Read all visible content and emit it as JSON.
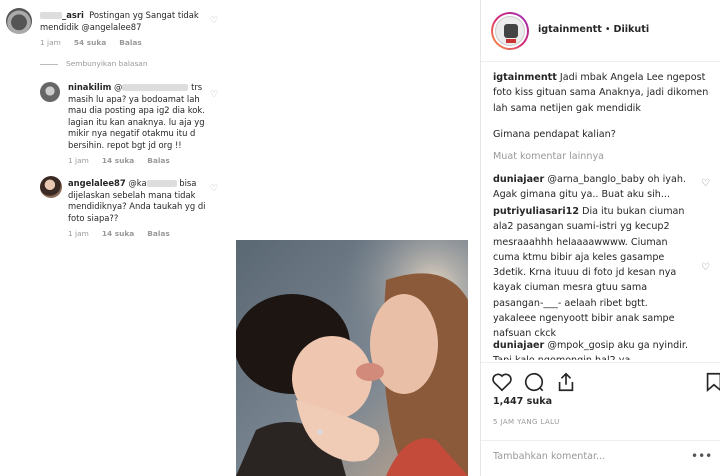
{
  "left_comments": {
    "top": {
      "username": "_asri",
      "text": "Postingan yg Sangat tidak mendidik @angelalee87",
      "time": "1 jam",
      "likes": "54 suka",
      "reply": "Balas"
    },
    "hide_replies": "Sembunyikan balasan",
    "reply1": {
      "username": "ninakilim",
      "mention": "@",
      "tail": "trs",
      "text": "masih lu apa? ya bodoamat lah mau dia posting apa ig2 dia kok. lagian itu kan anaknya. lu aja yg mikir nya negatif otakmu itu d bersihin. repot bgt jd org !!",
      "time": "1 jam",
      "likes": "14 suka",
      "reply": "Balas"
    },
    "reply2": {
      "username": "angelalee87",
      "mention": "@ka",
      "text": "bisa dijelaskan sebelah mana tidak mendidiknya? Anda taukah yg di foto siapa??",
      "time": "1 jam",
      "likes": "14 suka",
      "reply": "Balas"
    }
  },
  "post": {
    "username": "igtainmentt",
    "separator": "•",
    "follow_status": "Diikuti",
    "caption_user": "igtainmentt",
    "caption_text": "Jadi mbak Angela Lee ngepost foto kiss gituan sama Anaknya, jadi dikomen lah sama netijen gak mendidik",
    "question": "Gimana pendapat kalian?",
    "load_more": "Muat komentar lainnya",
    "comments": [
      {
        "user": "duniajaer",
        "text": "@arna_banglo_baby oh iyah. Agak gimana gitu ya.. Buat aku sih..."
      },
      {
        "user": "putriyuliasari12",
        "text": "Dia itu bukan ciuman ala2 pasangan suami-istri yg kecup2 mesraaahhh helaaaawwww. Ciuman cuma ktmu bibir aja keles gasampe 3detik. Krna ituuu di foto jd kesan nya kayak ciuman mesra gtuu sama pasangan-___- aelaah ribet bgtt. yakaleee ngenyoott bibir anak sampe nafsuan ckck"
      },
      {
        "user": "duniajaer",
        "text": "@mpok_gosip aku ga nyindir. Tapi kalo ngomongin hal2 ya"
      }
    ],
    "likes": "1,447 suka",
    "time_ago": "5 JAM YANG LALU",
    "add_comment_placeholder": "Tambahkan komentar...",
    "more_icon": "•••"
  },
  "colors": {
    "muted": "#999999",
    "text": "#262626",
    "border": "#efefef"
  }
}
